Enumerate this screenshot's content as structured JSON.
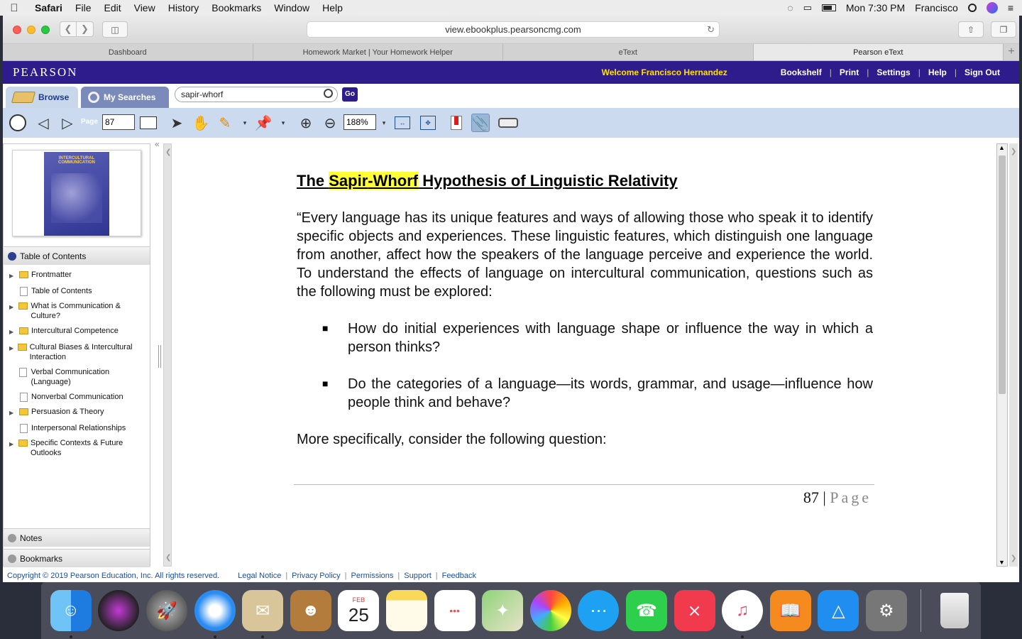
{
  "menubar": {
    "app": "Safari",
    "items": [
      "File",
      "Edit",
      "View",
      "History",
      "Bookmarks",
      "Window",
      "Help"
    ],
    "clock": "Mon 7:30 PM",
    "user": "Francisco"
  },
  "browser": {
    "url": "view.ebookplus.pearsoncmg.com",
    "tabs": [
      "Dashboard",
      "Homework Market | Your Homework Helper",
      "eText",
      "Pearson eText"
    ]
  },
  "pearson": {
    "logo": "PEARSON",
    "welcome": "Welcome Francisco Hernandez",
    "links": [
      "Bookshelf",
      "Print",
      "Settings",
      "Help",
      "Sign Out"
    ],
    "browse_label": "Browse",
    "search_tab_label": "My Searches",
    "search_value": "sapir-whorf",
    "go_label": "Go",
    "page_label": "Page",
    "page_value": "87",
    "zoom_value": "188%"
  },
  "sidebar": {
    "cover_title": "INTERCULTURAL COMMUNICATION",
    "toc_label": "Table of Contents",
    "toc": [
      {
        "label": "Frontmatter",
        "type": "folder"
      },
      {
        "label": "Table of Contents",
        "type": "doc"
      },
      {
        "label": "What is Communication & Culture?",
        "type": "folder"
      },
      {
        "label": "Intercultural Competence",
        "type": "folder"
      },
      {
        "label": "Cultural Biases & Intercultural Interaction",
        "type": "folder"
      },
      {
        "label": "Verbal Communication (Language)",
        "type": "doc"
      },
      {
        "label": "Nonverbal Communication",
        "type": "doc"
      },
      {
        "label": "Persuasion & Theory",
        "type": "folder"
      },
      {
        "label": "Interpersonal Relationships",
        "type": "doc"
      },
      {
        "label": "Specific Contexts & Future Outlooks",
        "type": "folder"
      }
    ],
    "notes_label": "Notes",
    "bookmarks_label": "Bookmarks"
  },
  "document": {
    "title_pre": "The ",
    "title_hl1": "Sapir",
    "title_dash": "-",
    "title_hl2": "Whorf",
    "title_post": " Hypothesis of Linguistic Relativity",
    "para1": "“Every language has its unique features and ways of allowing those who speak it to identify specific objects and experiences. These linguistic features, which distinguish one language from another, affect how the speakers of the language perceive and experience the world. To understand the effects of language on intercultural communication, questions such as the following must be explored:",
    "bullet1": "How do initial experiences with language shape or influence the way in which a person thinks?",
    "bullet2": "Do the categories of a language—its words, grammar, and usage—influence how people think and behave?",
    "para2": "More specifically, consider the following question:",
    "page_number": "87",
    "page_word": "Page"
  },
  "footer": {
    "copyright": "Copyright © 2019 Pearson Education, Inc. All rights reserved.",
    "links": [
      "Legal Notice",
      "Privacy Policy",
      "Permissions",
      "Support",
      "Feedback"
    ]
  },
  "dock": {
    "calendar_month": "FEB",
    "calendar_day": "25"
  }
}
